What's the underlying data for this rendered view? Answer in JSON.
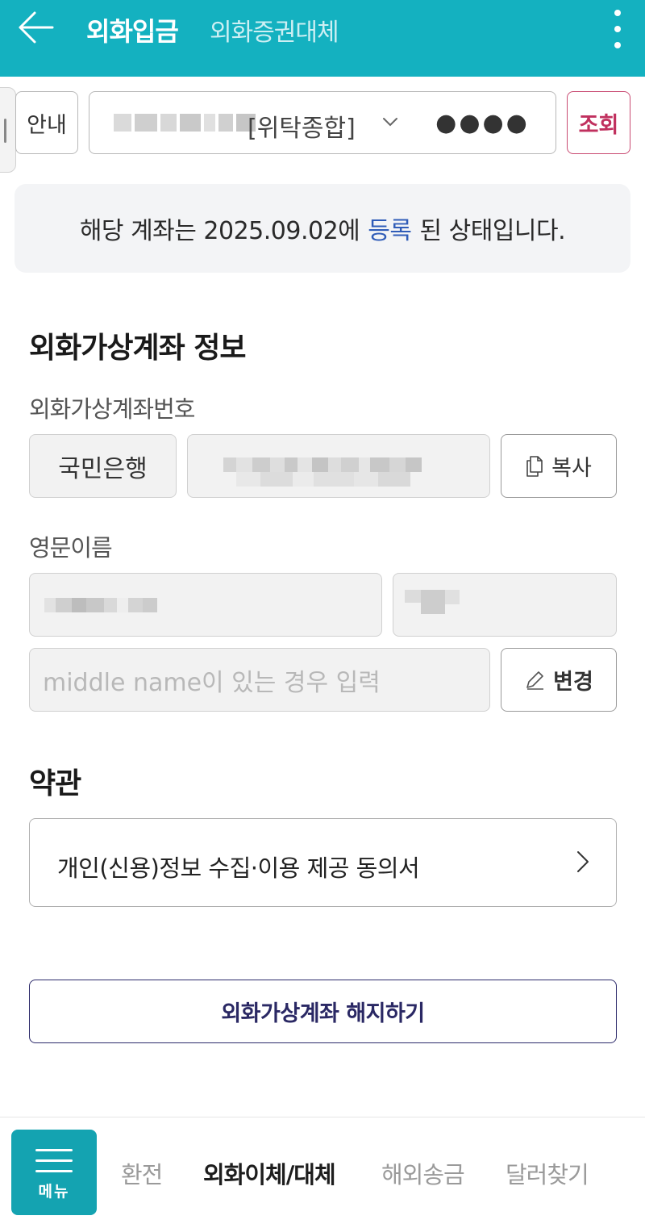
{
  "header": {
    "tabs": [
      {
        "label": "외화입금",
        "active": true
      },
      {
        "label": "외화증권대체",
        "active": false
      }
    ],
    "bg_color": "#14b1c0"
  },
  "account_bar": {
    "guide_label": "안내",
    "account_type": "[위탁종합]",
    "password_mask": "●●●●",
    "query_label": "조회"
  },
  "notice": {
    "prefix": "해당 계좌는 2025.09.02에",
    "highlight": "등록",
    "suffix": "된 상태입니다."
  },
  "virtual_account": {
    "section_title": "외화가상계좌 정보",
    "account_no_label": "외화가상계좌번호",
    "bank_name": "국민은행",
    "copy_label": "복사",
    "english_name_label": "영문이름",
    "middle_name_placeholder": "middle name이 있는 경우 입력",
    "change_label": "변경"
  },
  "terms": {
    "section_title": "약관",
    "items": [
      {
        "label": "개인(신용)정보 수집·이용 제공 동의서"
      }
    ]
  },
  "cancel_button_label": "외화가상계좌 해지하기",
  "bottom_nav": {
    "menu_label": "메뉴",
    "items": [
      {
        "label": "환전",
        "active": false
      },
      {
        "label": "외화이체/대체",
        "active": true
      },
      {
        "label": "해외송금",
        "active": false
      },
      {
        "label": "달러찾기",
        "active": false
      }
    ]
  }
}
